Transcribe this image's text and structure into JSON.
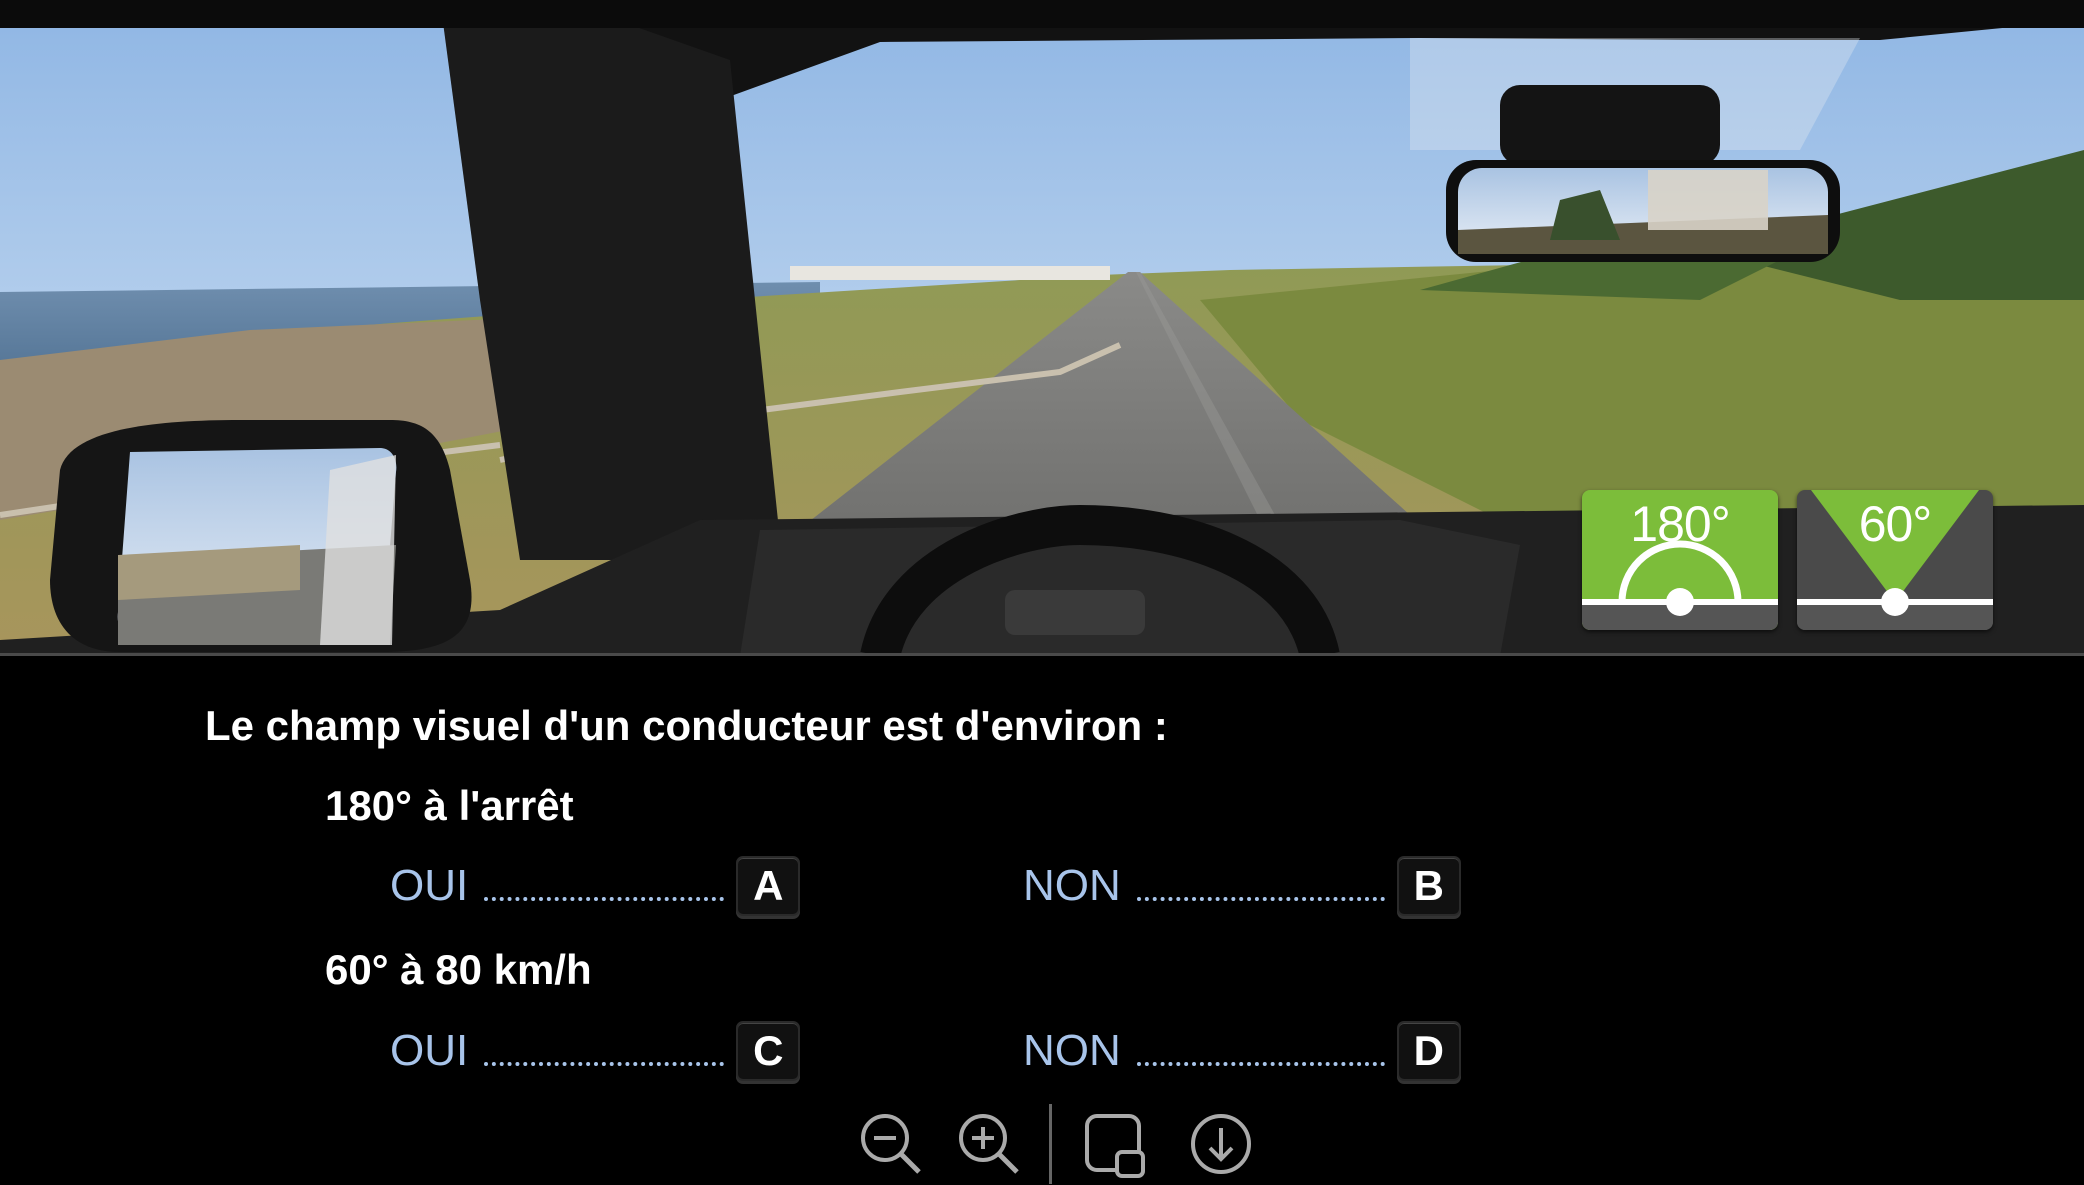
{
  "scene": {
    "badges": [
      {
        "id": "180",
        "label": "180°",
        "color": "#7cbd3a"
      },
      {
        "id": "60",
        "label": "60°",
        "color": "#4a4a4a"
      }
    ]
  },
  "quiz": {
    "question": "Le champ visuel d'un conducteur est d'environ :",
    "items": [
      {
        "statement": "180° à l'arrêt",
        "options": [
          {
            "word": "OUI",
            "key": "A"
          },
          {
            "word": "NON",
            "key": "B"
          }
        ]
      },
      {
        "statement": "60° à 80 km/h",
        "options": [
          {
            "word": "OUI",
            "key": "C"
          },
          {
            "word": "NON",
            "key": "D"
          }
        ]
      }
    ]
  },
  "toolbar": {
    "buttons": [
      "zoom-out-icon",
      "zoom-in-icon",
      "screen-icon",
      "download-icon"
    ]
  },
  "colors": {
    "option_text": "#a8c4ea",
    "background": "#000000"
  }
}
